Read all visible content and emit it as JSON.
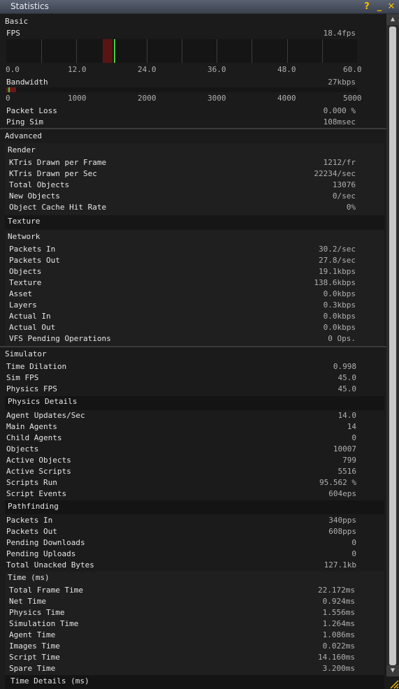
{
  "window": {
    "title": "Statistics",
    "help": "?",
    "minimize": "_",
    "close": "✕"
  },
  "basic": {
    "header": "Basic",
    "fps": {
      "label": "FPS",
      "value": "18.4fps",
      "ticks": [
        "0.0",
        "12.0",
        "24.0",
        "36.0",
        "48.0",
        "60.0"
      ],
      "current": 18.4,
      "max": 60.0
    },
    "bandwidth": {
      "label": "Bandwidth",
      "value": "27kbps",
      "ticks": [
        "0",
        "1000",
        "2000",
        "3000",
        "4000",
        "5000"
      ],
      "current": 27,
      "max": 5000
    },
    "rows": [
      {
        "label": "Packet Loss",
        "value": "0.000 %"
      },
      {
        "label": "Ping Sim",
        "value": "108msec"
      }
    ]
  },
  "advanced": {
    "header": "Advanced",
    "render": {
      "header": "Render",
      "rows": [
        {
          "label": "KTris Drawn per Frame",
          "value": "1212/fr"
        },
        {
          "label": "KTris Drawn per Sec",
          "value": "22234/sec"
        },
        {
          "label": "Total Objects",
          "value": "13076"
        },
        {
          "label": "New Objects",
          "value": "0/sec"
        },
        {
          "label": "Object Cache Hit Rate",
          "value": "0%"
        }
      ]
    },
    "texture": {
      "header": "Texture"
    },
    "network": {
      "header": "Network",
      "rows": [
        {
          "label": "Packets In",
          "value": "30.2/sec"
        },
        {
          "label": "Packets Out",
          "value": "27.8/sec"
        },
        {
          "label": "Objects",
          "value": "19.1kbps"
        },
        {
          "label": "Texture",
          "value": "138.6kbps"
        },
        {
          "label": "Asset",
          "value": "0.0kbps"
        },
        {
          "label": "Layers",
          "value": "0.3kbps"
        },
        {
          "label": "Actual In",
          "value": "0.0kbps"
        },
        {
          "label": "Actual Out",
          "value": "0.0kbps"
        },
        {
          "label": "VFS Pending Operations",
          "value": "0 Ops."
        }
      ]
    }
  },
  "simulator": {
    "header": "Simulator",
    "rows": [
      {
        "label": "Time Dilation",
        "value": "0.998"
      },
      {
        "label": "Sim FPS",
        "value": "45.0"
      },
      {
        "label": "Physics FPS",
        "value": "45.0"
      }
    ],
    "physics_details": {
      "header": "Physics Details"
    },
    "rows2": [
      {
        "label": "Agent Updates/Sec",
        "value": "14.0"
      },
      {
        "label": "Main Agents",
        "value": "14"
      },
      {
        "label": "Child Agents",
        "value": "0"
      },
      {
        "label": "Objects",
        "value": "10007"
      },
      {
        "label": "Active Objects",
        "value": "799"
      },
      {
        "label": "Active Scripts",
        "value": "5516"
      },
      {
        "label": "Scripts Run",
        "value": "95.562 %"
      },
      {
        "label": "Script Events",
        "value": "604eps"
      }
    ],
    "pathfinding": {
      "header": "Pathfinding"
    },
    "rows3": [
      {
        "label": "Packets In",
        "value": "340pps"
      },
      {
        "label": "Packets Out",
        "value": "608pps"
      },
      {
        "label": "Pending Downloads",
        "value": "0"
      },
      {
        "label": "Pending Uploads",
        "value": "0"
      },
      {
        "label": "Total Unacked Bytes",
        "value": "127.1kb"
      }
    ],
    "time": {
      "header": "Time (ms)",
      "rows": [
        {
          "label": "Total Frame Time",
          "value": "22.172ms"
        },
        {
          "label": "Net Time",
          "value": "0.924ms"
        },
        {
          "label": "Physics Time",
          "value": "1.556ms"
        },
        {
          "label": "Simulation Time",
          "value": "1.264ms"
        },
        {
          "label": "Agent Time",
          "value": "1.086ms"
        },
        {
          "label": "Images Time",
          "value": "0.022ms"
        },
        {
          "label": "Script Time",
          "value": "14.160ms"
        },
        {
          "label": "Spare Time",
          "value": "3.200ms"
        }
      ]
    },
    "time_details": {
      "header": "Time Details (ms)"
    }
  },
  "scrollbar": {
    "up": "▲",
    "down": "▼"
  }
}
